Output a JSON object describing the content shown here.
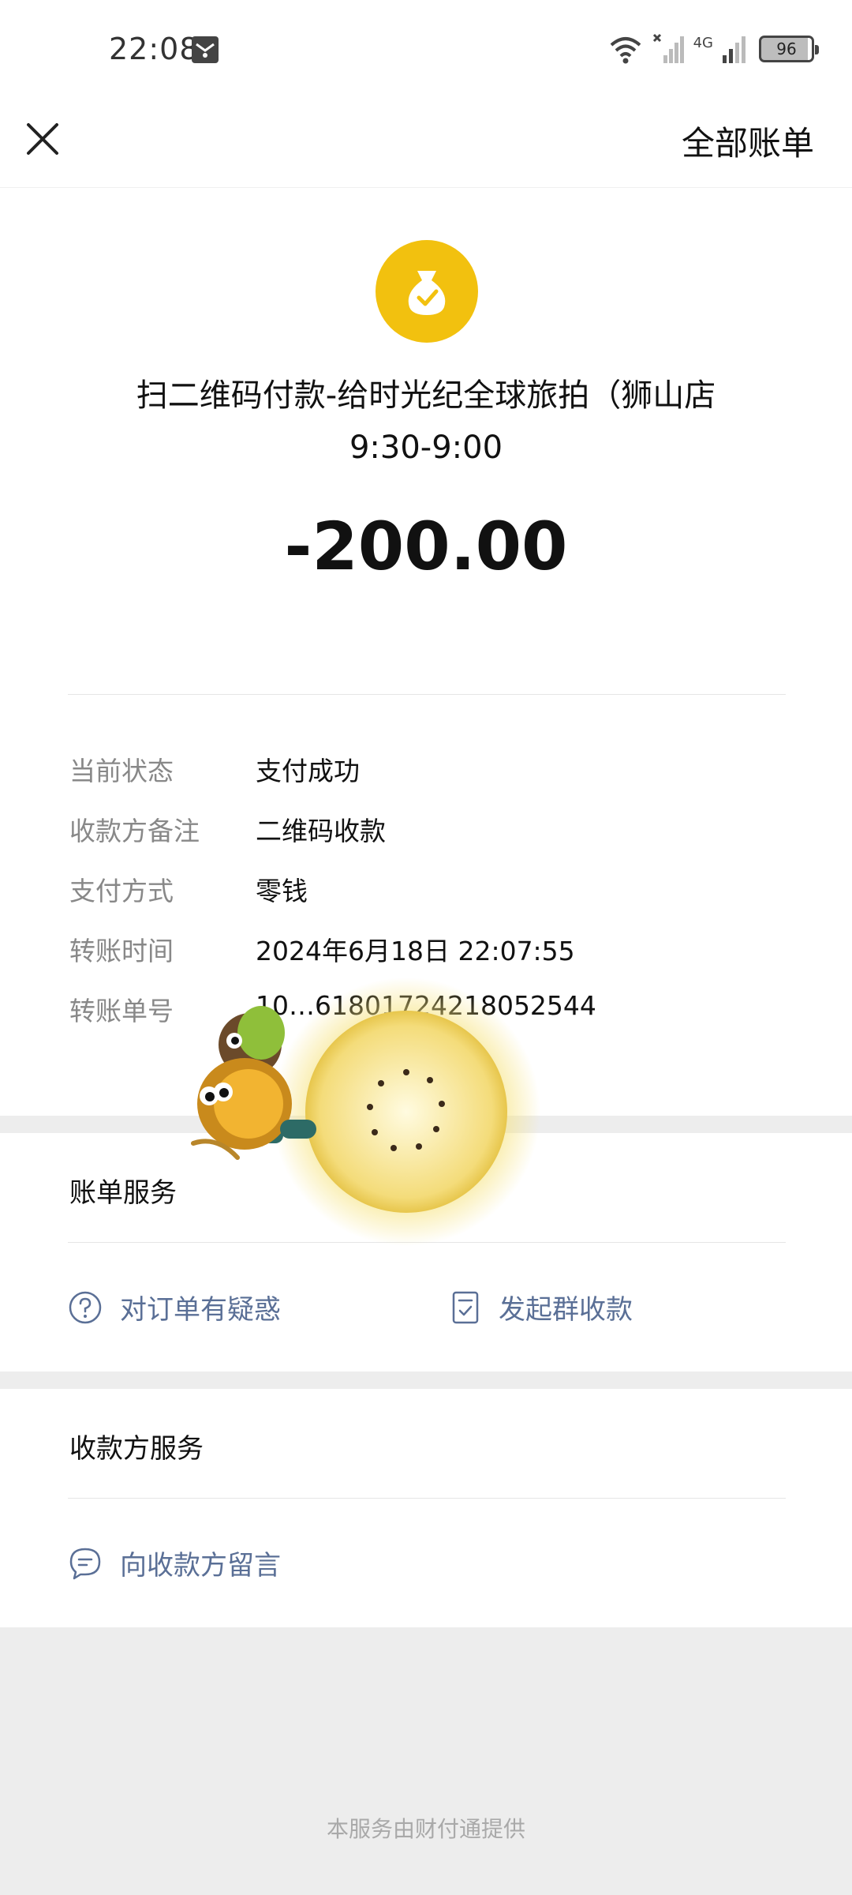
{
  "status_bar": {
    "time": "22:08",
    "network": "4G",
    "battery": "96"
  },
  "nav": {
    "right_link": "全部账单"
  },
  "colors": {
    "accent_yellow": "#f2c10f",
    "link_blue": "#5a6f96",
    "label_gray": "#888888"
  },
  "payment": {
    "merchant_line1": "扫二维码付款-给时光纪全球旅拍（狮山店",
    "merchant_line2": "9:30-9:00",
    "amount": "-200.00"
  },
  "details": [
    {
      "label": "当前状态",
      "value": "支付成功"
    },
    {
      "label": "收款方备注",
      "value": "二维码收款"
    },
    {
      "label": "支付方式",
      "value": "零钱"
    },
    {
      "label": "转账时间",
      "value": "2024年6月18日 22:07:55"
    },
    {
      "label": "转账单号",
      "value": "10…61801724218052544"
    }
  ],
  "bill_service": {
    "title": "账单服务",
    "actions": [
      {
        "label": "对订单有疑惑",
        "icon": "question-circle-icon"
      },
      {
        "label": "发起群收款",
        "icon": "document-check-icon"
      }
    ]
  },
  "payee_service": {
    "title": "收款方服务",
    "actions": [
      {
        "label": "向收款方留言",
        "icon": "chat-bubble-icon"
      }
    ]
  },
  "footer": "本服务由财付通提供"
}
